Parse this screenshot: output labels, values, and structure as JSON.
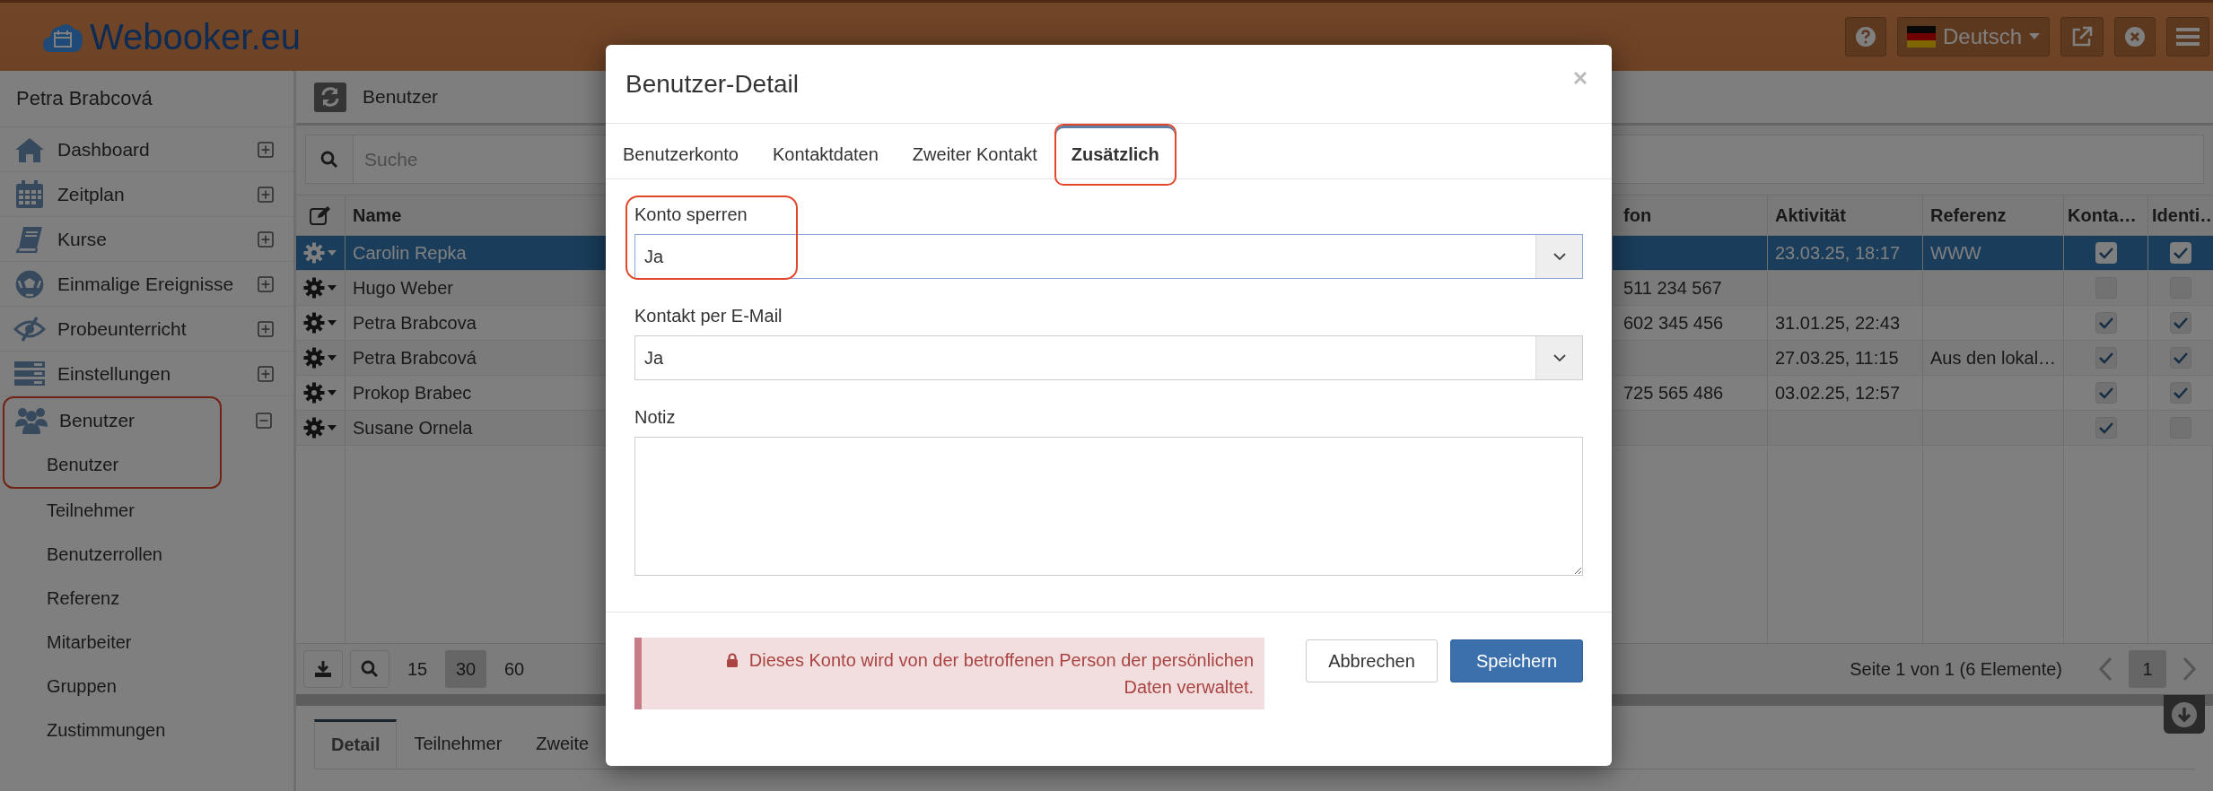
{
  "logo": {
    "text": "Webooker.eu"
  },
  "topbar": {
    "language": "Deutsch"
  },
  "sidebar": {
    "user": "Petra Brabcová",
    "items": [
      {
        "label": "Dashboard",
        "expanded": false
      },
      {
        "label": "Zeitplan",
        "expanded": false
      },
      {
        "label": "Kurse",
        "expanded": false
      },
      {
        "label": "Einmalige Ereignisse",
        "expanded": false
      },
      {
        "label": "Probeunterricht",
        "expanded": false
      },
      {
        "label": "Einstellungen",
        "expanded": false
      },
      {
        "label": "Benutzer",
        "expanded": true,
        "highlighted": true,
        "children": [
          {
            "label": "Benutzer",
            "highlighted": true
          },
          {
            "label": "Teilnehmer",
            "highlighted": false
          },
          {
            "label": "Benutzerrollen",
            "highlighted": false
          },
          {
            "label": "Referenz",
            "highlighted": false
          },
          {
            "label": "Mitarbeiter",
            "highlighted": false
          },
          {
            "label": "Gruppen",
            "highlighted": false
          },
          {
            "label": "Zustimmungen",
            "highlighted": false
          }
        ]
      }
    ]
  },
  "main": {
    "title": "Benutzer",
    "search": {
      "placeholder": "Suche"
    }
  },
  "table": {
    "columns": [
      "Name",
      "fon",
      "Aktivität",
      "Referenz",
      "Konta…",
      "Identi…"
    ],
    "rows": [
      {
        "name": "Carolin Repka",
        "activity": "23.03.25, 18:17",
        "reference": "WWW",
        "contact": true,
        "identity": true,
        "selected": true
      },
      {
        "name": "Hugo Weber",
        "phone": "511 234 567",
        "contact": false,
        "identity": false,
        "selected": false
      },
      {
        "name": "Petra Brabcova",
        "phone": "602 345 456",
        "activity": "31.01.25, 22:43",
        "contact": true,
        "identity": true,
        "selected": false
      },
      {
        "name": "Petra Brabcová",
        "activity": "27.03.25, 11:15",
        "reference": "Aus den lokal…",
        "contact": true,
        "identity": true,
        "selected": false
      },
      {
        "name": "Prokop Brabec",
        "phone": "725 565 486",
        "activity": "03.02.25, 12:57",
        "contact": true,
        "identity": true,
        "selected": false
      },
      {
        "name": "Susane Ornela",
        "contact": true,
        "identity": false,
        "selected": false
      }
    ]
  },
  "pager": {
    "sizes": [
      {
        "label": "15",
        "selected": false
      },
      {
        "label": "30",
        "selected": true
      },
      {
        "label": "60",
        "selected": false
      }
    ],
    "status": "Seite 1 von 1 (6 Elemente)",
    "pages": [
      {
        "label": "1",
        "selected": true
      }
    ]
  },
  "bottom_tabs": [
    {
      "label": "Detail",
      "selected": true
    },
    {
      "label": "Teilnehmer",
      "selected": false
    },
    {
      "label": "Zweite",
      "selected": false
    }
  ],
  "modal": {
    "title": "Benutzer-Detail",
    "tabs": [
      {
        "label": "Benutzerkonto",
        "selected": false,
        "highlighted": false
      },
      {
        "label": "Kontaktdaten",
        "selected": false,
        "highlighted": false
      },
      {
        "label": "Zweiter Kontakt",
        "selected": false,
        "highlighted": false
      },
      {
        "label": "Zusätzlich",
        "selected": true,
        "highlighted": true
      }
    ],
    "fields": [
      {
        "kind": "select",
        "label": "Konto sperren",
        "value": "Ja",
        "focused": true,
        "highlighted": true
      },
      {
        "kind": "select",
        "label": "Kontakt per E-Mail",
        "value": "Ja",
        "focused": false,
        "highlighted": false
      },
      {
        "kind": "textarea",
        "label": "Notiz"
      }
    ],
    "alert": "Dieses Konto wird von der betroffenen Person der persönlichen Daten verwaltet.",
    "buttons": [
      {
        "label": "Abbrechen",
        "kind": "default"
      },
      {
        "label": "Speichern",
        "kind": "primary"
      }
    ]
  }
}
